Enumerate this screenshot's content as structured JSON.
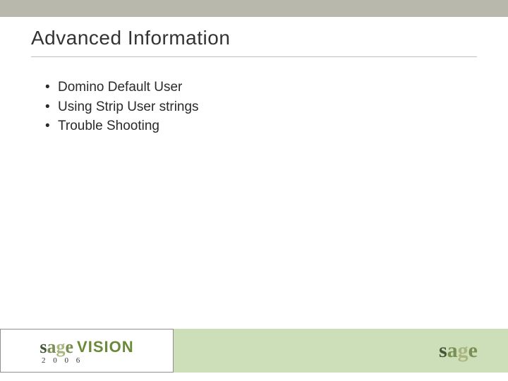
{
  "title": "Advanced Information",
  "bullets": [
    "Domino Default User",
    "Using Strip User strings",
    "Trouble Shooting"
  ],
  "footer": {
    "brand": "sage",
    "sub_brand": "VISION",
    "year": "2 0 0 6"
  }
}
